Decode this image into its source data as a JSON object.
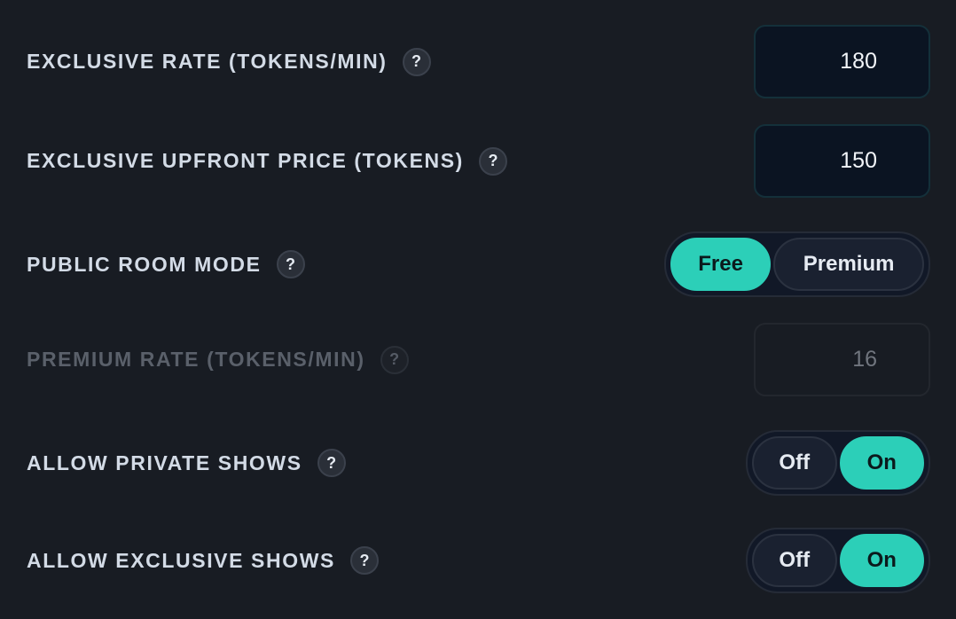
{
  "settings": {
    "exclusive_rate": {
      "label": "EXCLUSIVE RATE (TOKENS/MIN)",
      "help": "?",
      "value": "180"
    },
    "exclusive_upfront": {
      "label": "EXCLUSIVE UPFRONT PRICE (TOKENS)",
      "help": "?",
      "value": "150"
    },
    "public_room_mode": {
      "label": "PUBLIC ROOM MODE",
      "help": "?",
      "options": [
        "Free",
        "Premium"
      ],
      "selected": "Free"
    },
    "premium_rate": {
      "label": "PREMIUM RATE (TOKENS/MIN)",
      "help": "?",
      "value": "16",
      "disabled": true
    },
    "allow_private_shows": {
      "label": "ALLOW PRIVATE SHOWS",
      "help": "?",
      "options": [
        "Off",
        "On"
      ],
      "selected": "On"
    },
    "allow_exclusive_shows": {
      "label": "ALLOW EXCLUSIVE SHOWS",
      "help": "?",
      "options": [
        "Off",
        "On"
      ],
      "selected": "On"
    }
  },
  "colors": {
    "background": "#181c23",
    "accent": "#2ccfb8",
    "label": "#d3dbe6",
    "label_disabled": "#5a606a"
  }
}
